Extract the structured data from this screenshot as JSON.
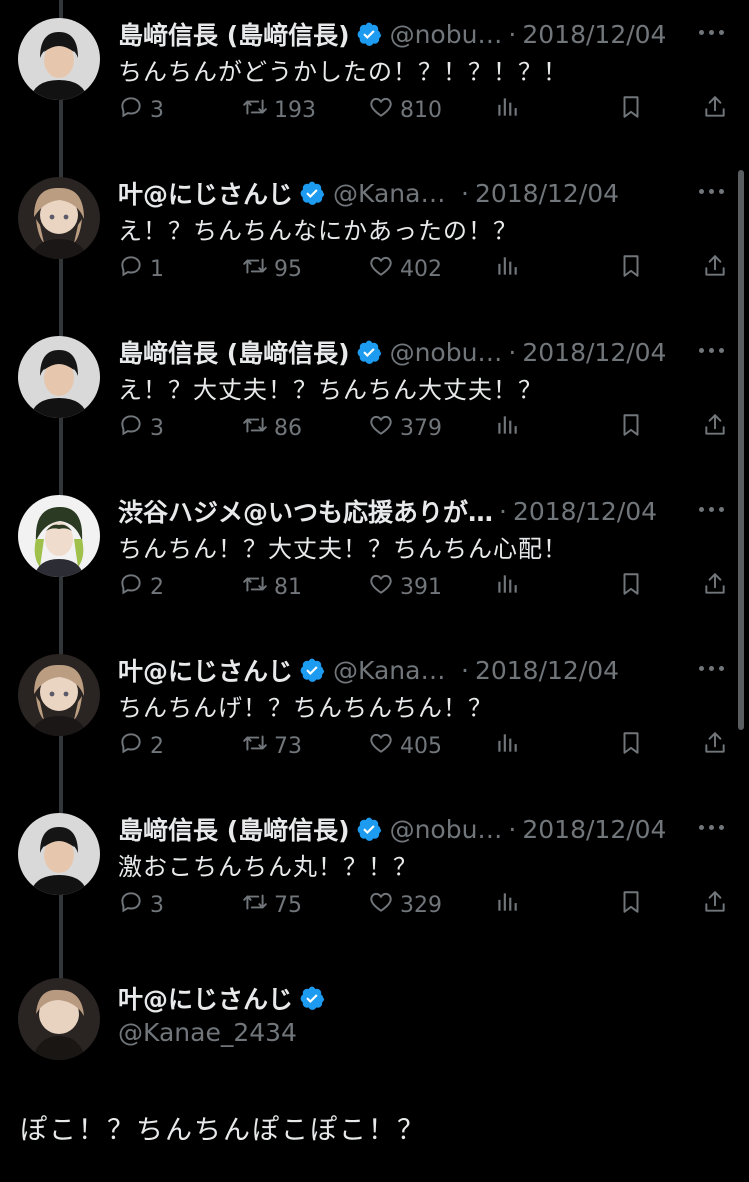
{
  "tweets": [
    {
      "name": "島﨑信長 (島﨑信長)",
      "handle": "@nobu…",
      "date": "2018/12/04",
      "text": "ちんちんがどうかしたの！？！？！？！",
      "replies": "3",
      "retweets": "193",
      "likes": "810",
      "avatar": "nobunaga"
    },
    {
      "name": "叶@にじさんじ",
      "handle": "@Kanae_2…",
      "date": "2018/12/04",
      "text": "え！？ちんちんなにかあったの！？",
      "replies": "1",
      "retweets": "95",
      "likes": "402",
      "avatar": "kanae"
    },
    {
      "name": "島﨑信長 (島﨑信長)",
      "handle": "@nobu…",
      "date": "2018/12/04",
      "text": "え！？大丈夫！？ちんちん大丈夫！？",
      "replies": "3",
      "retweets": "86",
      "likes": "379",
      "avatar": "nobunaga"
    },
    {
      "name": "渋谷ハジメ@いつも応援ありが…",
      "handle": "",
      "date": "2018/12/04",
      "text": "ちんちん！？大丈夫！？ちんちん心配！",
      "replies": "2",
      "retweets": "81",
      "likes": "391",
      "avatar": "hajime"
    },
    {
      "name": "叶@にじさんじ",
      "handle": "@Kanae_2…",
      "date": "2018/12/04",
      "text": "ちんちんげ！？ちんちんちん！？",
      "replies": "2",
      "retweets": "73",
      "likes": "405",
      "avatar": "kanae"
    },
    {
      "name": "島﨑信長 (島﨑信長)",
      "handle": "@nobu…",
      "date": "2018/12/04",
      "text": "激おこちんちん丸！？！？",
      "replies": "3",
      "retweets": "75",
      "likes": "329",
      "avatar": "nobunaga"
    }
  ],
  "main_tweet": {
    "name": "叶@にじさんじ",
    "handle": "@Kanae_2434",
    "text": "ぽこ！？ちんちんぽこぽこ！？"
  },
  "icons": [
    "reply-icon",
    "retweet-icon",
    "like-icon",
    "views-icon",
    "bookmark-icon",
    "share-icon",
    "verified-icon",
    "more-icon"
  ],
  "colors": {
    "background": "#000000",
    "text": "#e7e9ea",
    "muted": "#71767b",
    "verified": "#1d9bf0",
    "thread_line": "#333639"
  }
}
